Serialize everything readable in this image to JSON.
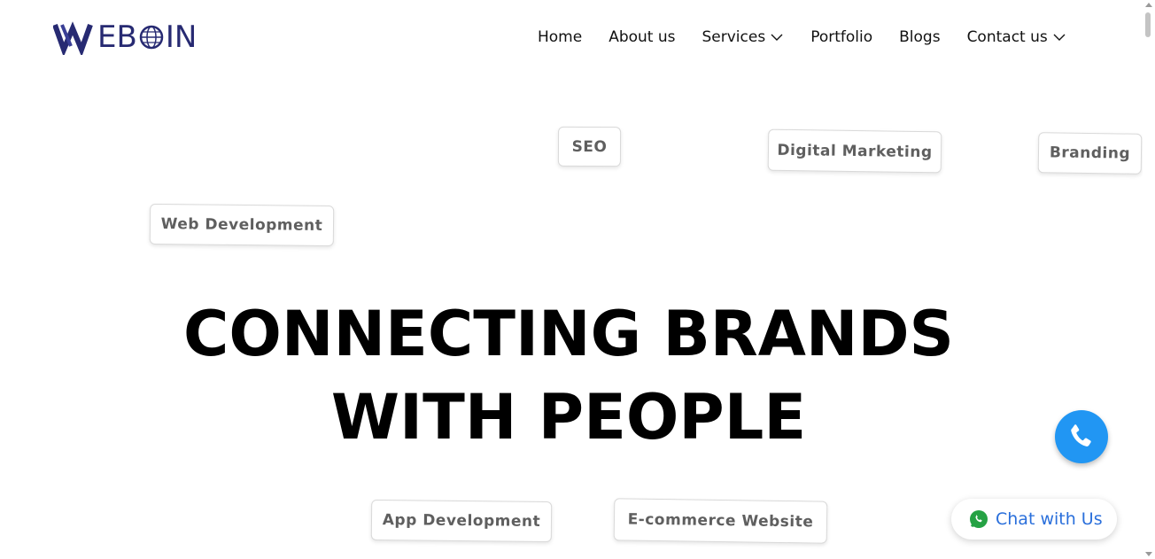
{
  "header": {
    "logo_text": "WEBOIN",
    "logo_prefix": "W",
    "logo_suffix_1": "EB",
    "logo_suffix_2": "IN",
    "nav": [
      {
        "label": "Home",
        "has_dropdown": false
      },
      {
        "label": "About us",
        "has_dropdown": false
      },
      {
        "label": "Services",
        "has_dropdown": true
      },
      {
        "label": "Portfolio",
        "has_dropdown": false
      },
      {
        "label": "Blogs",
        "has_dropdown": false
      },
      {
        "label": "Contact us",
        "has_dropdown": true
      }
    ]
  },
  "tags": {
    "seo": "SEO",
    "digital_marketing": "Digital Marketing",
    "branding": "Branding",
    "web_development": "Web Development",
    "app_development": "App Development",
    "ecommerce": "E-commerce Website"
  },
  "hero": {
    "line1": "CONNECTING BRANDS",
    "line2": "WITH PEOPLE"
  },
  "floating": {
    "call_icon": "phone-icon",
    "chat_icon": "whatsapp-icon",
    "chat_label": "Chat with Us"
  },
  "colors": {
    "brand": "#272a72",
    "call_button": "#2196f3",
    "chat_text": "#2a6fdb",
    "whatsapp": "#25a244"
  }
}
